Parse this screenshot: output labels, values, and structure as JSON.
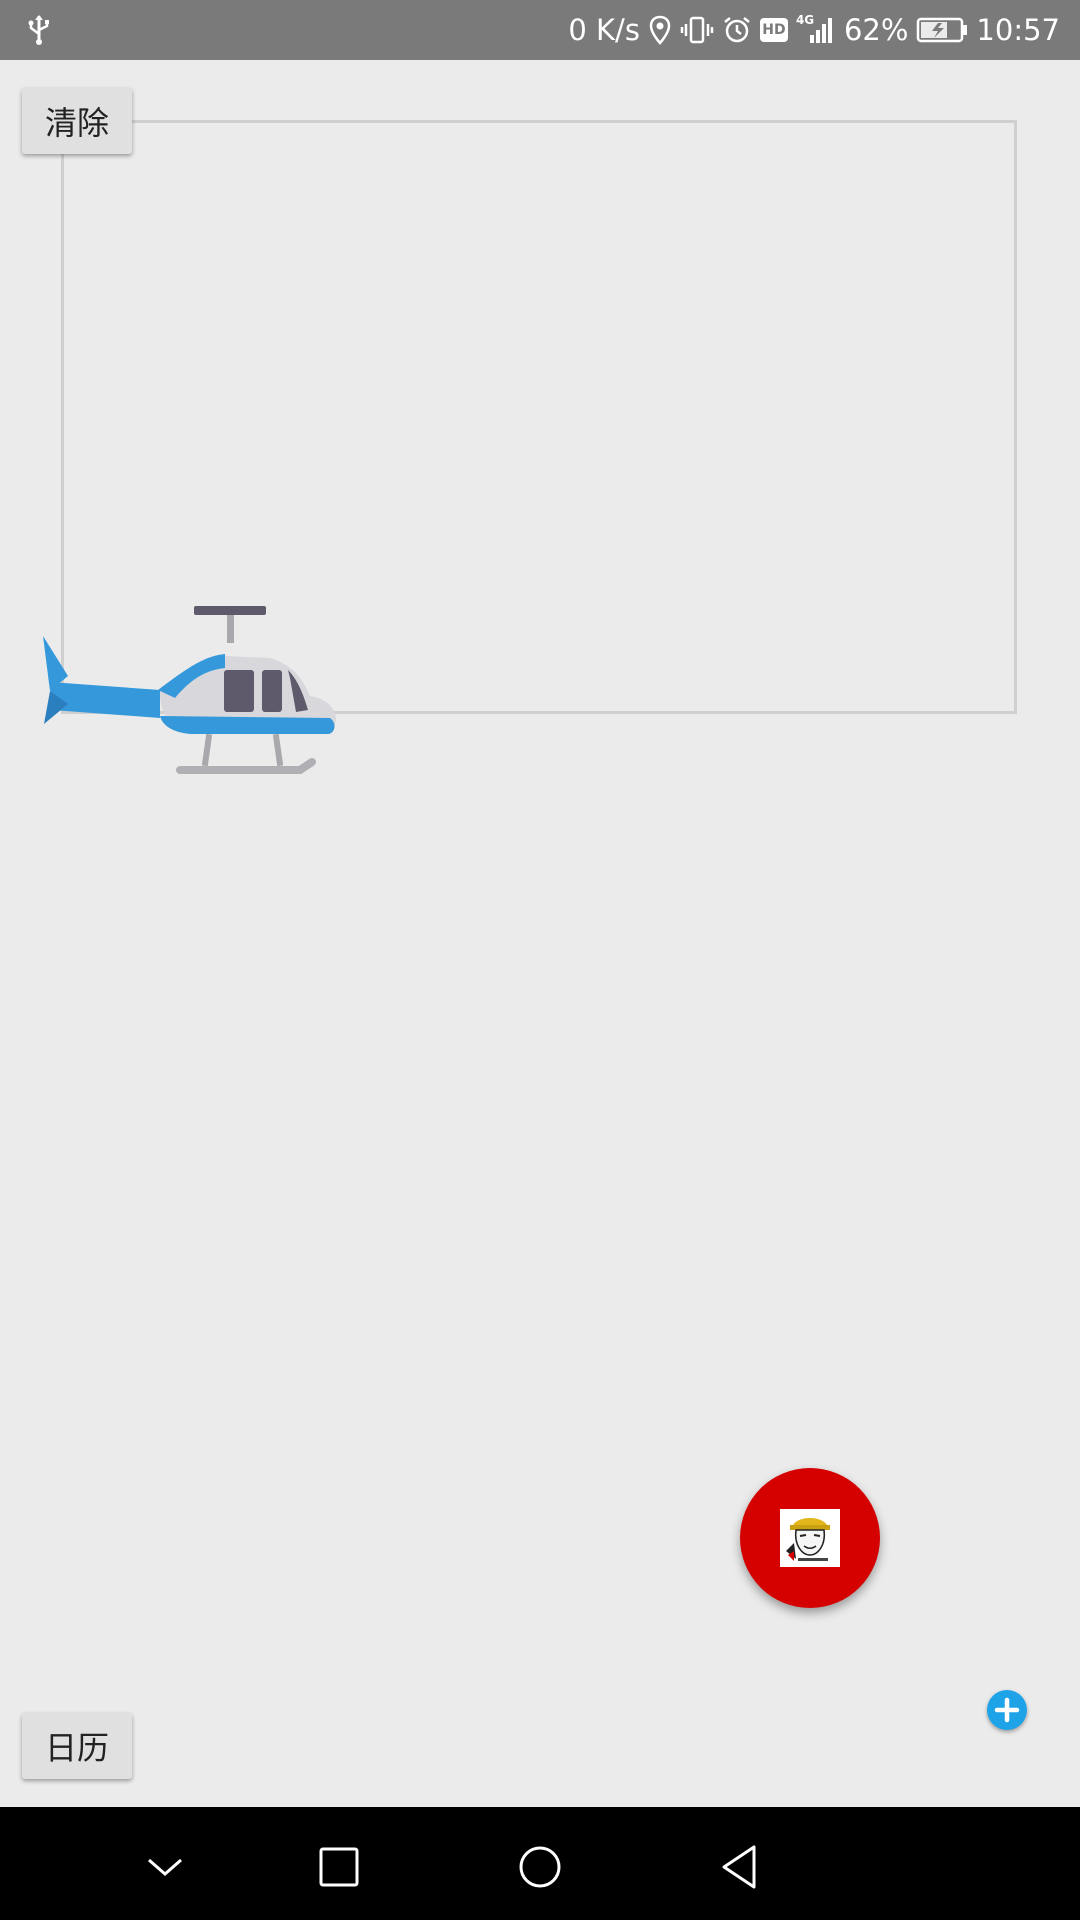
{
  "status_bar": {
    "network_speed": "0 K/s",
    "network_type": "4G",
    "hd_label": "HD",
    "battery_percent": "62%",
    "time": "10:57",
    "icons": [
      "usb-icon",
      "location-icon",
      "vibrate-icon",
      "alarm-icon",
      "hd-icon",
      "signal-icon",
      "battery-charging-icon"
    ]
  },
  "buttons": {
    "clear_label": "清除",
    "calendar_label": "日历"
  },
  "canvas": {
    "object": "helicopter-icon"
  },
  "fab": {
    "avatar_icon": "meme-face-icon",
    "add_icon": "plus-icon",
    "color": "#d50000",
    "add_color": "#1ea3e8"
  },
  "nav_bar": {
    "icons": [
      "chevron-down-icon",
      "recent-apps-icon",
      "home-icon",
      "back-icon"
    ]
  }
}
